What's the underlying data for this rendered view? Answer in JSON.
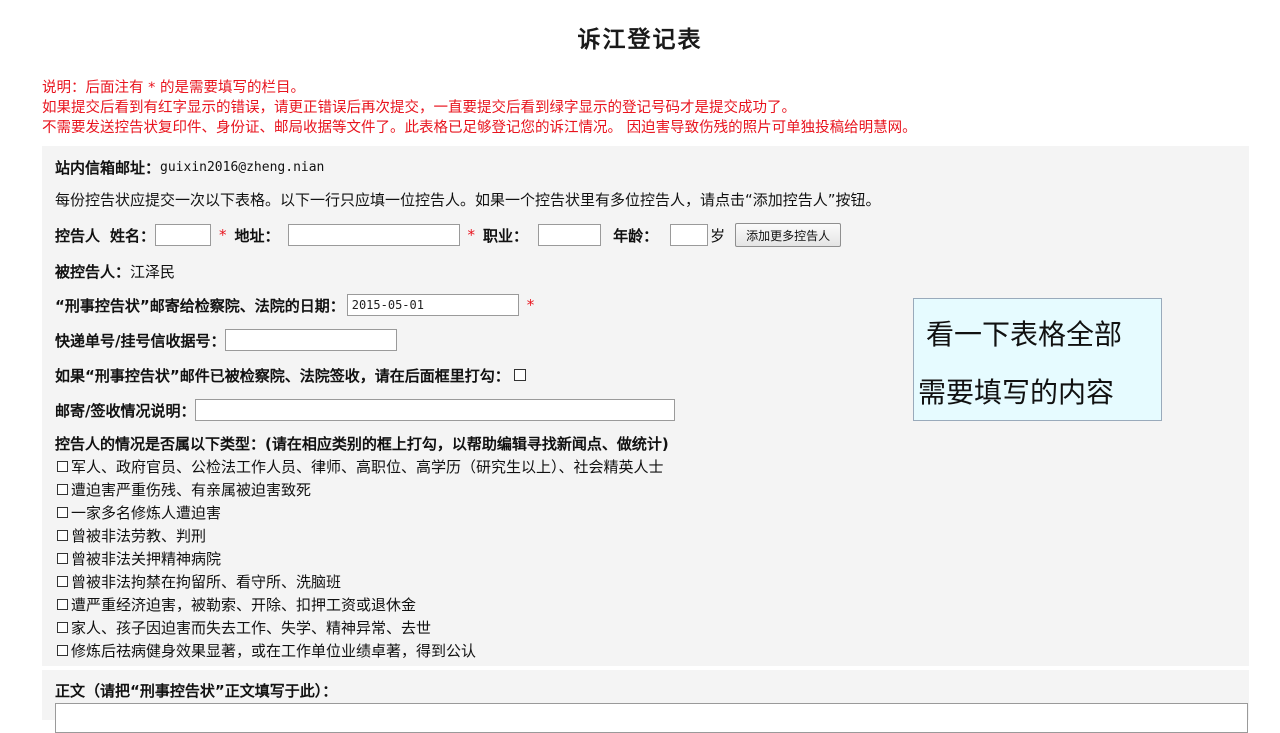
{
  "title": "诉江登记表",
  "notes": [
    "说明：后面注有 * 的是需要填写的栏目。",
    "如果提交后看到有红字显示的错误，请更正错误后再次提交，一直要提交后看到绿字显示的登记号码才是提交成功了。",
    "不需要发送控告状复印件、身份证、邮局收据等文件了。此表格已足够登记您的诉江情况。 因迫害导致伤残的照片可单独投稿给明慧网。"
  ],
  "mailbox": {
    "label": "站内信箱邮址：",
    "value": "guixin2016@zheng.nian"
  },
  "instruction": "每份控告状应提交一次以下表格。以下一行只应填一位控告人。如果一个控告状里有多位控告人，请点击“添加控告人”按钮。",
  "accuser": {
    "label": "控告人",
    "name_label": "姓名：",
    "address_label": "地址：",
    "job_label": "职业：",
    "age_label": "年龄：",
    "age_unit": "岁",
    "required_mark": "*",
    "name_value": "",
    "address_value": "",
    "job_value": "",
    "age_value": "",
    "add_button": "添加更多控告人"
  },
  "accused": {
    "label": "被控告人：",
    "value": "江泽民"
  },
  "mail_date": {
    "label": "“刑事控告状”邮寄给检察院、法院的日期：",
    "value": "2015-05-01",
    "required_mark": "*"
  },
  "tracking": {
    "label": "快递单号/挂号信收据号：",
    "value": ""
  },
  "signed": {
    "label": "如果“刑事控告状”邮件已被检察院、法院签收，请在后面框里打勾："
  },
  "mail_note": {
    "label": "邮寄/签收情况说明：",
    "value": ""
  },
  "categories": {
    "heading": "控告人的情况是否属以下类型：(请在相应类别的框上打勾，以帮助编辑寻找新闻点、做统计)",
    "items": [
      "军人、政府官员、公检法工作人员、律师、高职位、高学历（研究生以上）、社会精英人士",
      "遭迫害严重伤残、有亲属被迫害致死",
      "一家多名修炼人遭迫害",
      "曾被非法劳教、判刑",
      "曾被非法关押精神病院",
      "曾被非法拘禁在拘留所、看守所、洗脑班",
      "遭严重经济迫害，被勒索、开除、扣押工资或退休金",
      "家人、孩子因迫害而失去工作、失学、精神异常、去世",
      "修炼后祛病健身效果显著，或在工作单位业绩卓著，得到公认"
    ]
  },
  "body_text": {
    "label": "正文（请把“刑事控告状”正文填写于此）：",
    "value": ""
  },
  "callout": {
    "line1": "看一下表格全部",
    "line2": "需要填写的内容"
  },
  "colors": {
    "required_red": "#e8141e",
    "callout_bg": "#e6fbff",
    "panel_bg": "#f4f4f4"
  }
}
